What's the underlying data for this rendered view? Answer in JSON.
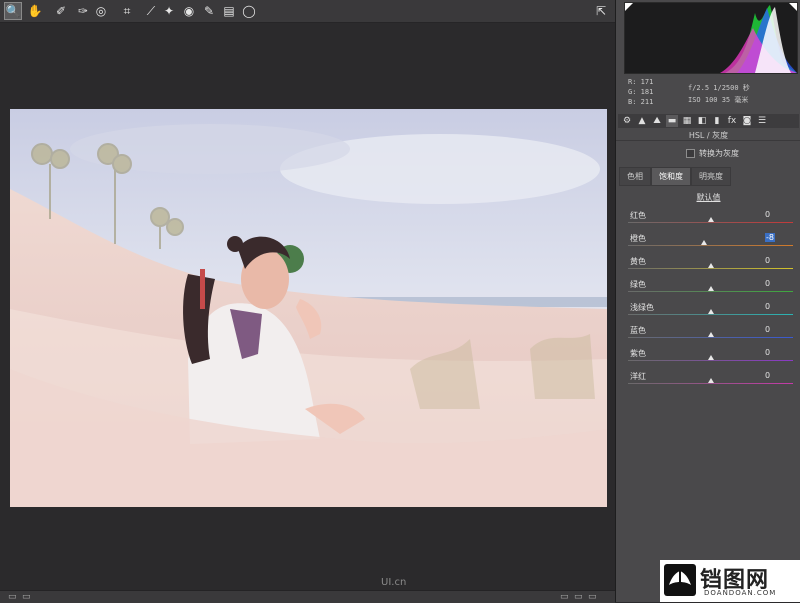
{
  "toolbar": {
    "tools": [
      {
        "name": "zoom-tool-icon",
        "glyph": "🔍",
        "active": true
      },
      {
        "name": "hand-tool-icon",
        "glyph": "✋"
      },
      {
        "name": "white-balance-tool-icon",
        "glyph": "✐"
      },
      {
        "name": "color-sampler-tool-icon",
        "glyph": "✑"
      },
      {
        "name": "targeted-adjustment-tool-icon",
        "glyph": "◎"
      },
      {
        "name": "crop-tool-icon",
        "glyph": "⌗"
      },
      {
        "name": "straighten-tool-icon",
        "glyph": "⟋"
      },
      {
        "name": "spot-removal-tool-icon",
        "glyph": "✦"
      },
      {
        "name": "red-eye-tool-icon",
        "glyph": "◉"
      },
      {
        "name": "adjustment-brush-icon",
        "glyph": "✎"
      },
      {
        "name": "graduated-filter-icon",
        "glyph": "▤"
      },
      {
        "name": "radial-filter-icon",
        "glyph": "◯"
      }
    ],
    "open_prefs_icon": "⇱"
  },
  "readout": {
    "r": "R: 171",
    "g": "G: 181",
    "b": "B: 211",
    "aperture_shutter": "f/2.5  1/2500 秒",
    "iso_focal": "ISO 100  35 毫米"
  },
  "panel_tabs": [
    "⚙",
    "▲",
    "⛰",
    "▬",
    "▦",
    "◧",
    "▮",
    "fx",
    "◙",
    "☰"
  ],
  "section": {
    "title": "HSL / 灰度",
    "grayscale_label": "转换为灰度",
    "subtabs": [
      "色相",
      "饱和度",
      "明亮度"
    ],
    "selected_subtab": 1,
    "default_link": "默认值"
  },
  "sliders": [
    {
      "label": "红色",
      "value": "0",
      "position": 0.5,
      "color": "#c33a3a"
    },
    {
      "label": "橙色",
      "value": "-8",
      "position": 0.46,
      "color": "#d27a2a",
      "editing": true
    },
    {
      "label": "黄色",
      "value": "0",
      "position": 0.5,
      "color": "#d3c32a"
    },
    {
      "label": "绿色",
      "value": "0",
      "position": 0.5,
      "color": "#3fa83f"
    },
    {
      "label": "浅绿色",
      "value": "0",
      "position": 0.5,
      "color": "#2ab3b3"
    },
    {
      "label": "蓝色",
      "value": "0",
      "position": 0.5,
      "color": "#3a5ad0"
    },
    {
      "label": "紫色",
      "value": "0",
      "position": 0.5,
      "color": "#8a3ac4"
    },
    {
      "label": "洋红",
      "value": "0",
      "position": 0.5,
      "color": "#c43aa8"
    }
  ],
  "watermarks": {
    "left": "UI.cn",
    "right_title": "铛图网",
    "right_sub": "DOANDOAN.COM"
  }
}
